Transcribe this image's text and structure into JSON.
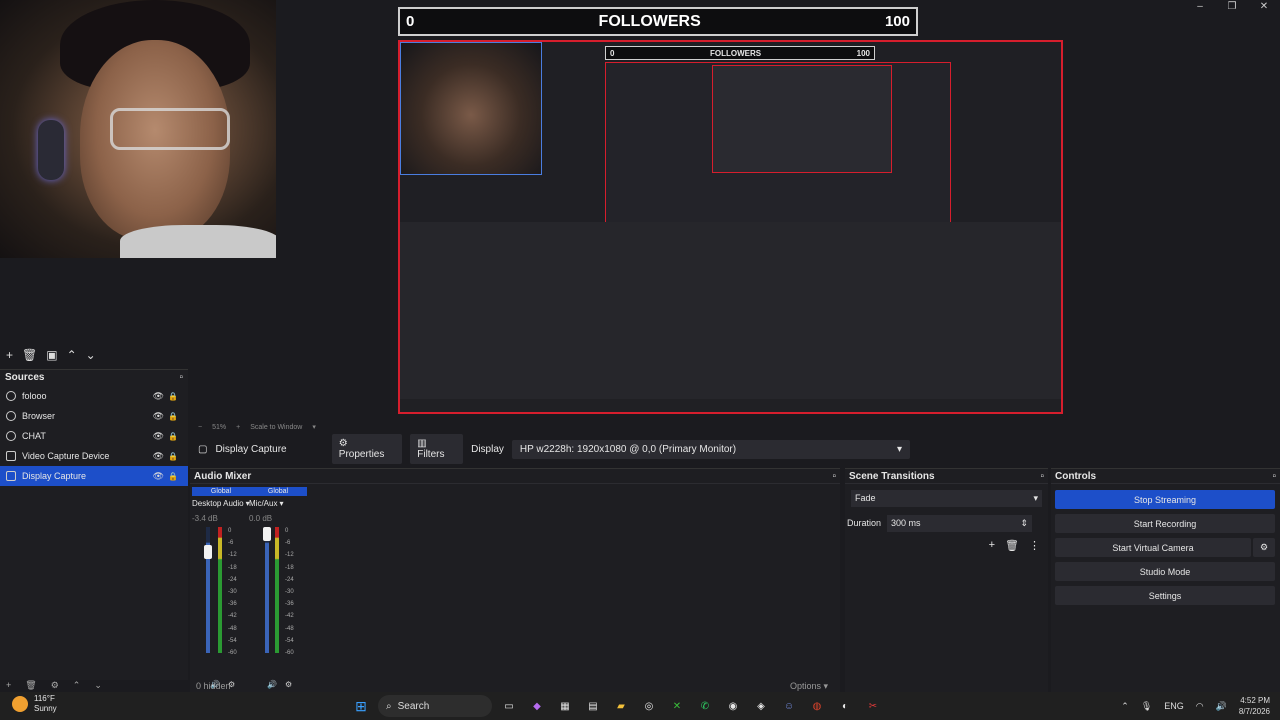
{
  "preview": {
    "followers_min": "0",
    "followers_title": "FOLLOWERS",
    "followers_max": "100",
    "zoom": "51%",
    "scale_mode": "Scale to Window"
  },
  "window": {
    "minimize": "–",
    "restore": "❐",
    "close": "✕"
  },
  "sources": {
    "title": "Sources",
    "items": [
      {
        "label": "folooo",
        "icon": "globe-icon"
      },
      {
        "label": "Browser",
        "icon": "globe-icon"
      },
      {
        "label": "CHAT",
        "icon": "globe-icon"
      },
      {
        "label": "Video Capture Device",
        "icon": "camera-icon"
      },
      {
        "label": "Display Capture",
        "icon": "monitor-icon"
      }
    ]
  },
  "props_bar": {
    "source_name": "Display Capture",
    "properties": "Properties",
    "filters": "Filters",
    "display_label": "Display",
    "display_value": "HP w2228h: 1920x1080 @ 0,0 (Primary Monitor)"
  },
  "audio_mixer": {
    "title": "Audio Mixer",
    "channels": [
      {
        "tag": "Global",
        "name": "Desktop Audio",
        "db": "-3.4 dB",
        "level": 0.93
      },
      {
        "tag": "Global",
        "name": "Mic/Aux",
        "db": "0.0 dB",
        "level": 1.0
      }
    ],
    "ticks": [
      "0",
      "-6",
      "-12",
      "-18",
      "-24",
      "-30",
      "-36",
      "-42",
      "-48",
      "-54",
      "-60"
    ],
    "hidden_label": "0 hidden",
    "options": "Options"
  },
  "scene_transitions": {
    "title": "Scene Transitions",
    "transition": "Fade",
    "duration_label": "Duration",
    "duration_value": "300 ms"
  },
  "controls": {
    "title": "Controls",
    "stop_streaming": "Stop Streaming",
    "start_recording": "Start Recording",
    "start_virtual_camera": "Start Virtual Camera",
    "studio_mode": "Studio Mode",
    "settings": "Settings"
  },
  "taskbar": {
    "temp": "116°F",
    "weather": "Sunny",
    "search": "Search",
    "lang": "ENG",
    "time": "4:52 PM",
    "date": "8/7/2026"
  }
}
